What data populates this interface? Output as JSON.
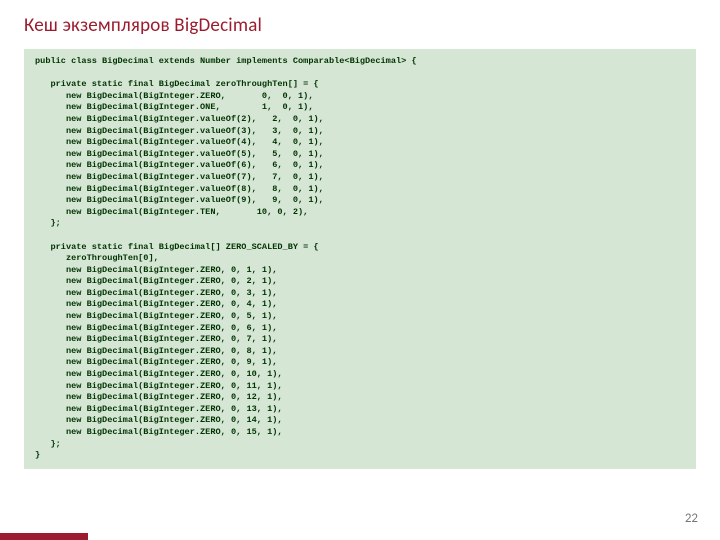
{
  "title": "Кеш экземпляров BigDecimal",
  "page_number": "22",
  "code": "public class BigDecimal extends Number implements Comparable<BigDecimal> {\n\n   private static final BigDecimal zeroThroughTen[] = {\n      new BigDecimal(BigInteger.ZERO,       0,  0, 1),\n      new BigDecimal(BigInteger.ONE,        1,  0, 1),\n      new BigDecimal(BigInteger.valueOf(2),   2,  0, 1),\n      new BigDecimal(BigInteger.valueOf(3),   3,  0, 1),\n      new BigDecimal(BigInteger.valueOf(4),   4,  0, 1),\n      new BigDecimal(BigInteger.valueOf(5),   5,  0, 1),\n      new BigDecimal(BigInteger.valueOf(6),   6,  0, 1),\n      new BigDecimal(BigInteger.valueOf(7),   7,  0, 1),\n      new BigDecimal(BigInteger.valueOf(8),   8,  0, 1),\n      new BigDecimal(BigInteger.valueOf(9),   9,  0, 1),\n      new BigDecimal(BigInteger.TEN,       10, 0, 2),\n   };\n\n   private static final BigDecimal[] ZERO_SCALED_BY = {\n      zeroThroughTen[0],\n      new BigDecimal(BigInteger.ZERO, 0, 1, 1),\n      new BigDecimal(BigInteger.ZERO, 0, 2, 1),\n      new BigDecimal(BigInteger.ZERO, 0, 3, 1),\n      new BigDecimal(BigInteger.ZERO, 0, 4, 1),\n      new BigDecimal(BigInteger.ZERO, 0, 5, 1),\n      new BigDecimal(BigInteger.ZERO, 0, 6, 1),\n      new BigDecimal(BigInteger.ZERO, 0, 7, 1),\n      new BigDecimal(BigInteger.ZERO, 0, 8, 1),\n      new BigDecimal(BigInteger.ZERO, 0, 9, 1),\n      new BigDecimal(BigInteger.ZERO, 0, 10, 1),\n      new BigDecimal(BigInteger.ZERO, 0, 11, 1),\n      new BigDecimal(BigInteger.ZERO, 0, 12, 1),\n      new BigDecimal(BigInteger.ZERO, 0, 13, 1),\n      new BigDecimal(BigInteger.ZERO, 0, 14, 1),\n      new BigDecimal(BigInteger.ZERO, 0, 15, 1),\n   };\n}"
}
